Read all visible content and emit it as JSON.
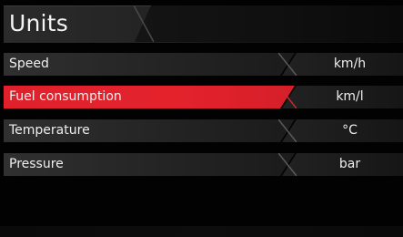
{
  "header": {
    "title": "Units"
  },
  "units": [
    {
      "label": "Speed",
      "value": "km/h",
      "selected": false
    },
    {
      "label": "Fuel consumption",
      "value": "km/l",
      "selected": true
    },
    {
      "label": "Temperature",
      "value": "°C",
      "selected": false
    },
    {
      "label": "Pressure",
      "value": "bar",
      "selected": false
    }
  ],
  "colors": {
    "selection": "#e0212b",
    "background": "#020202",
    "row": "#2a2a2a"
  }
}
